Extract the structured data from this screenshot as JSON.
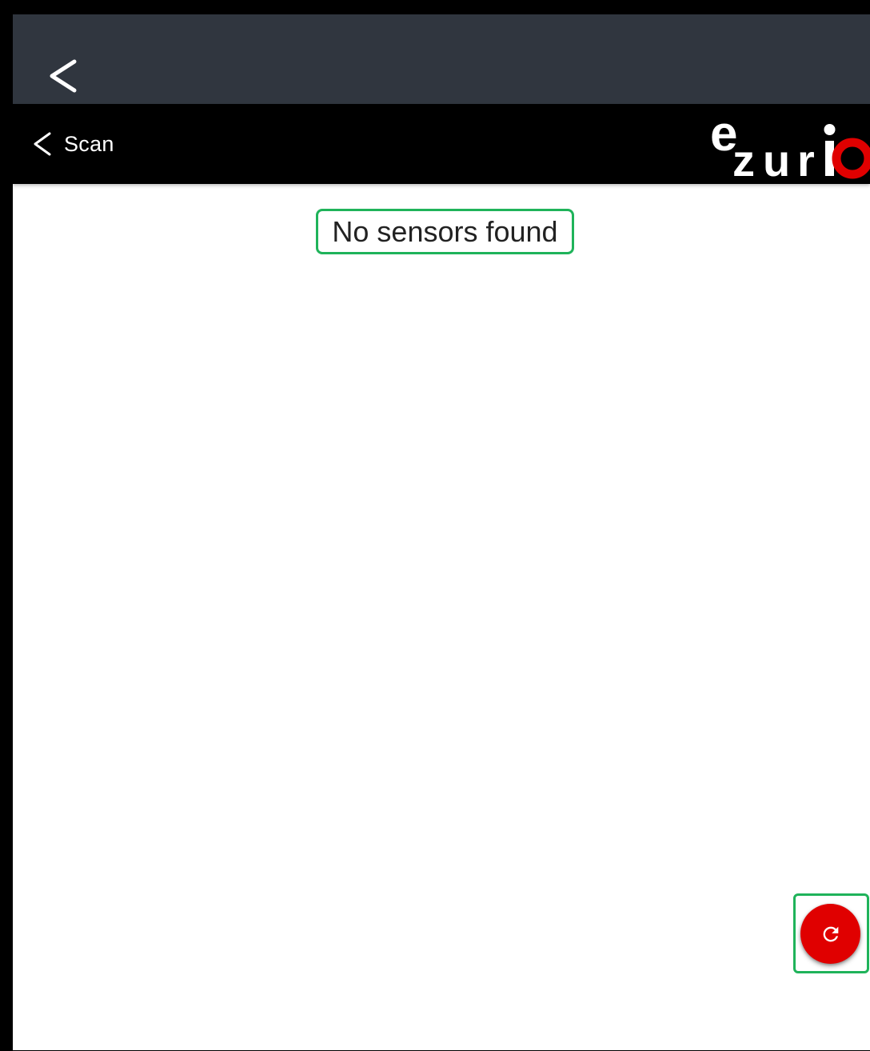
{
  "app": {
    "top_back_icon": "chevron-left-icon",
    "nav": {
      "back_icon": "chevron-left-icon",
      "back_label": "Scan",
      "logo_text": "ezurio",
      "logo_colors": {
        "text": "#ffffff",
        "accent": "#e00000"
      }
    },
    "content": {
      "empty_message": "No sensors found"
    },
    "fab": {
      "icon": "refresh-icon",
      "color": "#e00000"
    },
    "colors": {
      "status_bar": "#30363f",
      "nav_bar": "#000000",
      "highlight": "#1fb35a"
    }
  }
}
